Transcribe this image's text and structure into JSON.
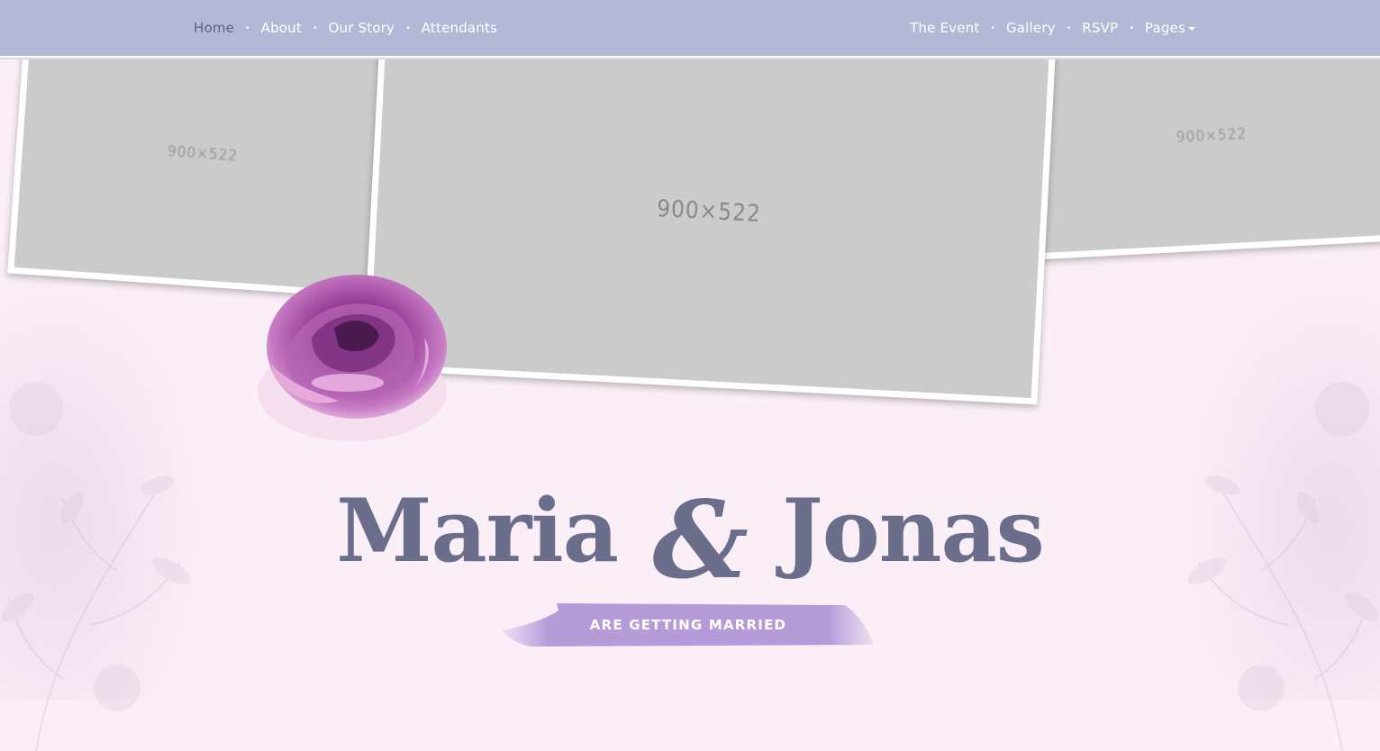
{
  "nav": {
    "left": [
      "Home",
      "About",
      "Our Story",
      "Attendants"
    ],
    "right": [
      "The Event",
      "Gallery",
      "RSVP",
      "Pages"
    ],
    "separator": "•",
    "active": "Home"
  },
  "slider": {
    "left_placeholder": "900×522",
    "center_placeholder": "900×522",
    "right_placeholder": "900×522"
  },
  "hero": {
    "name1": "Maria",
    "ampersand": "&",
    "name2": "Jonas",
    "tagline": "ARE GETTING MARRIED"
  },
  "colors": {
    "navbar": "#b4b8d6",
    "background": "#fbeff7",
    "title": "#6a6e8a",
    "banner": "#b69bd9",
    "rose": "#a0459b"
  },
  "icons": [
    "rose-flower-icon",
    "dropdown-caret-icon",
    "floral-leaf-icon"
  ]
}
